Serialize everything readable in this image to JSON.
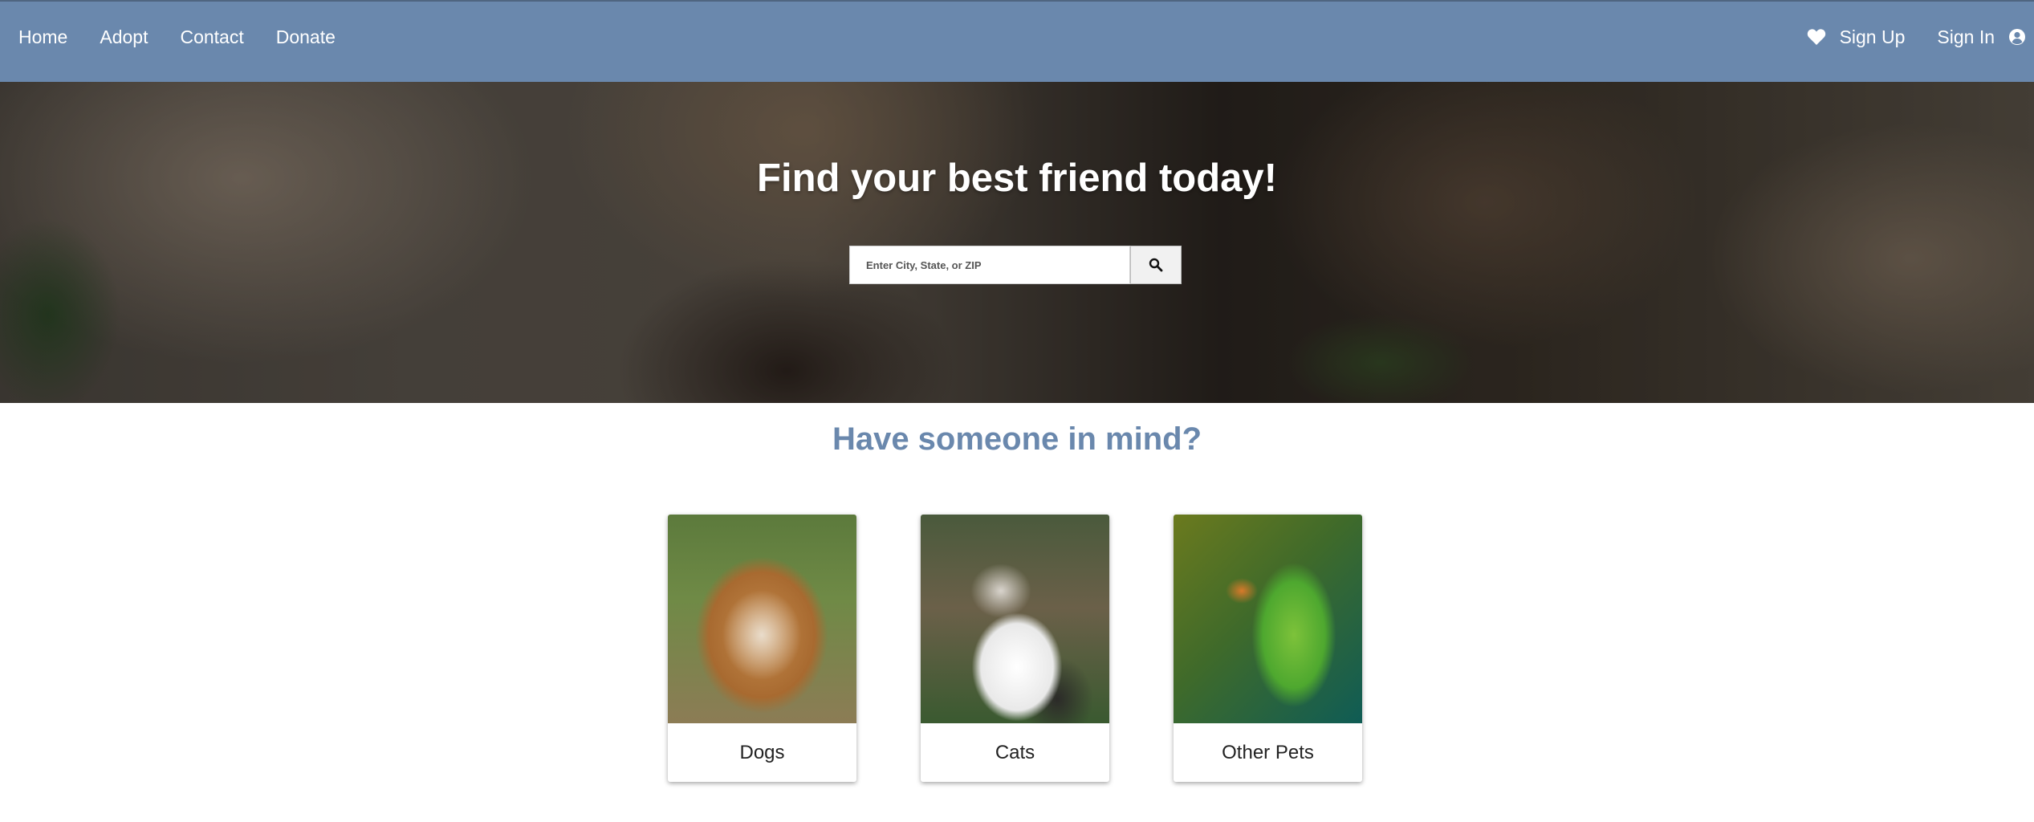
{
  "nav": {
    "home": "Home",
    "adopt": "Adopt",
    "contact": "Contact",
    "donate": "Donate",
    "sign_up": "Sign Up",
    "sign_in": "Sign In",
    "icons": {
      "favorites": "heart-icon",
      "account": "user-circle-icon"
    },
    "background_color": "#6a88ad",
    "text_color": "#ffffff"
  },
  "hero": {
    "title": "Find your best friend today!",
    "search": {
      "placeholder": "Enter City, State, or ZIP",
      "value": "",
      "button_icon": "search-icon"
    }
  },
  "categories_section": {
    "title": "Have someone in mind?",
    "title_color": "#6a88ad",
    "cards": [
      {
        "label": "Dogs",
        "image": "dog-photo"
      },
      {
        "label": "Cats",
        "image": "cat-photo"
      },
      {
        "label": "Other Pets",
        "image": "parrot-photo"
      }
    ]
  }
}
